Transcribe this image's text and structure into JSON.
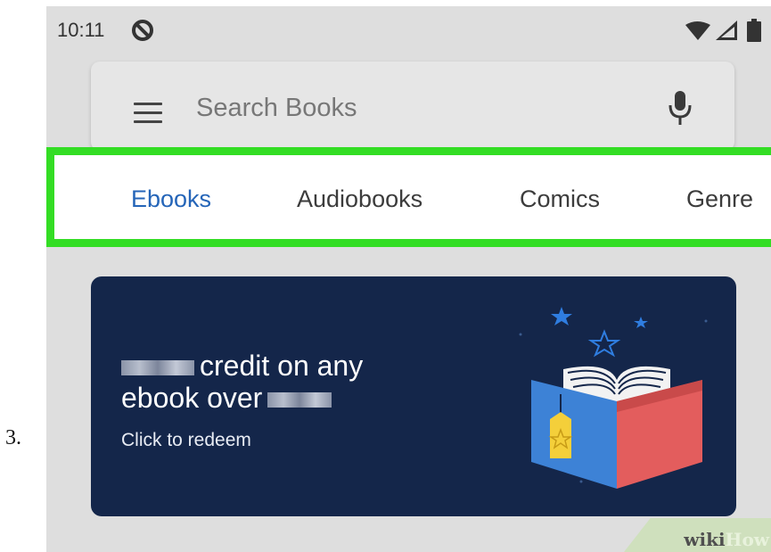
{
  "step": {
    "number": "3."
  },
  "status_bar": {
    "time": "10:11",
    "icons": [
      "cast-icon",
      "wifi-icon",
      "signal-icon",
      "battery-icon"
    ]
  },
  "search": {
    "placeholder": "Search Books",
    "icons": [
      "menu-icon",
      "mic-icon"
    ]
  },
  "tabs": [
    {
      "label": "Ebooks",
      "active": true
    },
    {
      "label": "Audiobooks",
      "active": false
    },
    {
      "label": "Comics",
      "active": false
    },
    {
      "label": "Genre",
      "active": false
    }
  ],
  "promo": {
    "line1": "credit on any",
    "line2": "ebook over",
    "cta": "Click to redeem",
    "illustration": "open-book-with-stars"
  },
  "watermark": {
    "text_wiki": "wiki",
    "text_how": "How"
  },
  "colors": {
    "accent": "#2565b8",
    "highlight": "#33dd24",
    "banner": "#14264a",
    "background": "#dedede"
  }
}
